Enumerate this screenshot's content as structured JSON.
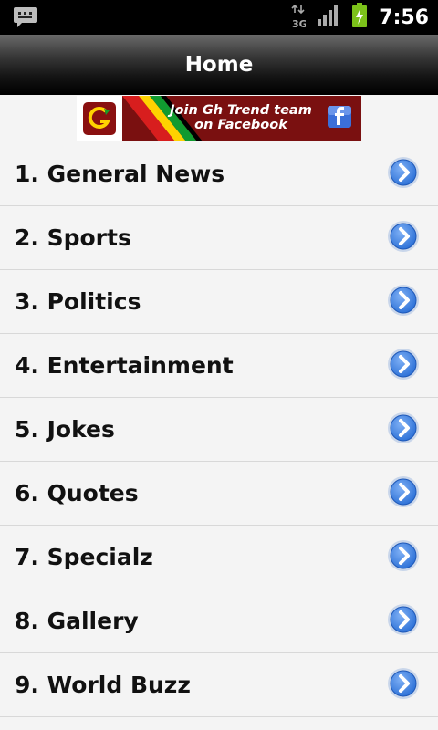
{
  "status_bar": {
    "time": "7:56",
    "network": "3G"
  },
  "header": {
    "title": "Home"
  },
  "banner": {
    "line1": "Join Gh Trend team",
    "line2": "on Facebook"
  },
  "menu": [
    {
      "label": "1. General News"
    },
    {
      "label": "2. Sports"
    },
    {
      "label": "3. Politics"
    },
    {
      "label": "4. Entertainment"
    },
    {
      "label": "5. Jokes"
    },
    {
      "label": "6. Quotes"
    },
    {
      "label": "7. Specialz"
    },
    {
      "label": "8. Gallery"
    },
    {
      "label": "9. World Buzz"
    }
  ],
  "colors": {
    "arrow_blue": "#2a6fd6",
    "battery_green": "#7cc21a",
    "banner_red": "#7a1010"
  },
  "icons": {
    "notification": "message-icon",
    "data": "3g-icon",
    "signal": "signal-icon",
    "battery": "battery-charging-icon",
    "banner_logo": "gh-trend-logo",
    "facebook": "facebook-icon",
    "row": "chevron-right-icon"
  }
}
